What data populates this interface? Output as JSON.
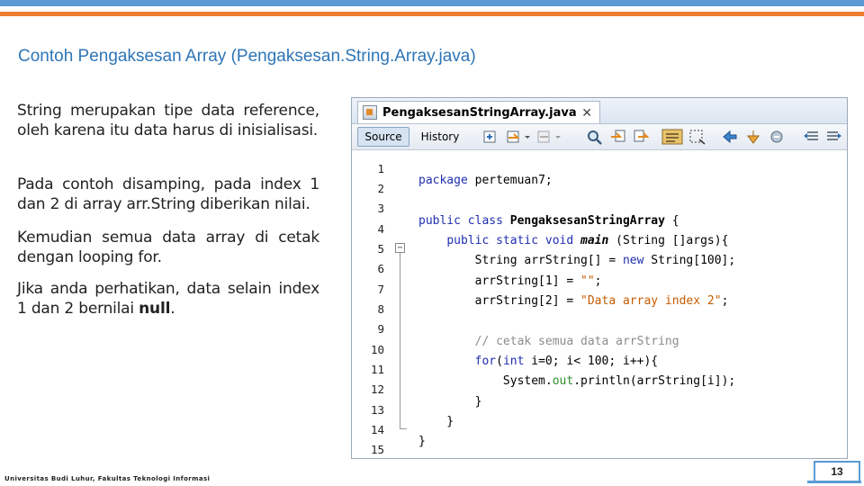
{
  "slide": {
    "title": "Contoh Pengaksesan Array (Pengaksesan.String.Array.java)",
    "paragraphs": [
      "String merupakan tipe data reference, oleh karena itu data harus di inisialisasi.",
      "Pada contoh disamping, pada index 1 dan 2 di array arr.String diberikan nilai.",
      "Kemudian semua data array di cetak dengan looping for."
    ],
    "para4_text": "Jika anda perhatikan, data selain index 1 dan 2 bernilai ",
    "para4_bold": "null",
    "para4_end": ".",
    "footer": "Universitas Budi Luhur, Fakultas Teknologi Informasi",
    "page_number": "13"
  },
  "ide": {
    "file_tab": "PengaksesanStringArray.java",
    "close_glyph": "✕",
    "tab_source": "Source",
    "tab_history": "History",
    "line_numbers": [
      "1",
      "2",
      "3",
      "4",
      "5",
      "6",
      "7",
      "8",
      "9",
      "10",
      "11",
      "12",
      "13",
      "14",
      "15"
    ],
    "fold_glyph": "−",
    "code": {
      "l2_kw": "package",
      "l2_rest": " pertemuan7;",
      "l4_kw": "public class",
      "l4_cls": " PengaksesanStringArray",
      "l4_rest": " {",
      "l5_indent": "    ",
      "l5_kw": "public static void",
      "l5_sp": " ",
      "l5_main": "main",
      "l5_rest": " (String []args){",
      "l6_pre": "        String arrString[] = ",
      "l6_kw": "new",
      "l6_rest": " String[100];",
      "l7_pre": "        arrString[1] = ",
      "l7_str": "\"\"",
      "l7_end": ";",
      "l8_pre": "        arrString[2] = ",
      "l8_str": "\"Data array index 2\"",
      "l8_end": ";",
      "l10": "        // cetak semua data arrString",
      "l11_indent": "        ",
      "l11_kw": "for",
      "l11_mid": "(",
      "l11_kw2": "int",
      "l11_rest": " i=0; i< 100; i++){",
      "l12_pre": "            System.",
      "l12_field": "out",
      "l12_rest": ".println(arrString[i]);",
      "l13": "        }",
      "l14": "    }",
      "l15": "}"
    }
  }
}
